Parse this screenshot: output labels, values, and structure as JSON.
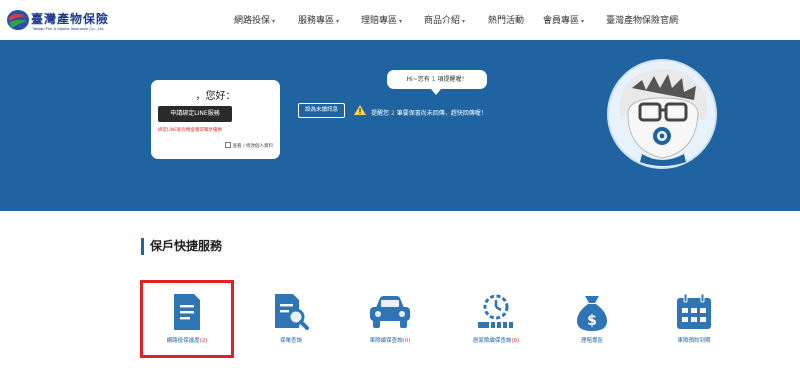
{
  "header": {
    "logo_zh": "臺灣產物保險",
    "logo_en": "Taiwan Fire & Marine Insurance Co., Ltd.",
    "nav": [
      {
        "label": "網路投保",
        "has_dropdown": true
      },
      {
        "label": "服務專區",
        "has_dropdown": true
      },
      {
        "label": "理賠專區",
        "has_dropdown": true
      },
      {
        "label": "商品介紹",
        "has_dropdown": true
      },
      {
        "label": "熱門活動",
        "has_dropdown": false
      },
      {
        "label": "會員專區",
        "has_dropdown": true
      },
      {
        "label": "臺灣產物保險官網",
        "has_dropdown": false
      }
    ]
  },
  "hero": {
    "greeting": "，您好：",
    "line_button": "申請綁定LINE服務",
    "line_note": "綁定LINE能有機會獲得獨享優惠",
    "edit_link": "查看 / 修改個人資料",
    "bubble_prefix": "Hi~您有",
    "bubble_count": "1",
    "bubble_suffix": "項提醒喔！",
    "unread_button": "設為未讀訊息",
    "warning_prefix": "提醒您",
    "warning_count": "2",
    "warning_suffix": "筆要保書尚未回傳，趕快回傳喔！"
  },
  "services": {
    "title": "保戶快捷服務",
    "items": [
      {
        "label": "網路投保進度",
        "count": "(2)",
        "icon": "document-icon"
      },
      {
        "label": "保單查詢",
        "count": "",
        "icon": "document-search-icon"
      },
      {
        "label": "車險續保查詢",
        "count": "(0)",
        "icon": "car-icon"
      },
      {
        "label": "居家險續保查詢",
        "count": "(0)",
        "icon": "clock-progress-icon"
      },
      {
        "label": "理賠專區",
        "count": "",
        "icon": "money-bag-icon"
      },
      {
        "label": "車險預約到期",
        "count": "",
        "icon": "calendar-icon"
      }
    ]
  },
  "colors": {
    "brand_blue": "#1f64a0",
    "alert_red": "#e02222",
    "warning_yellow": "#ffd24a"
  }
}
